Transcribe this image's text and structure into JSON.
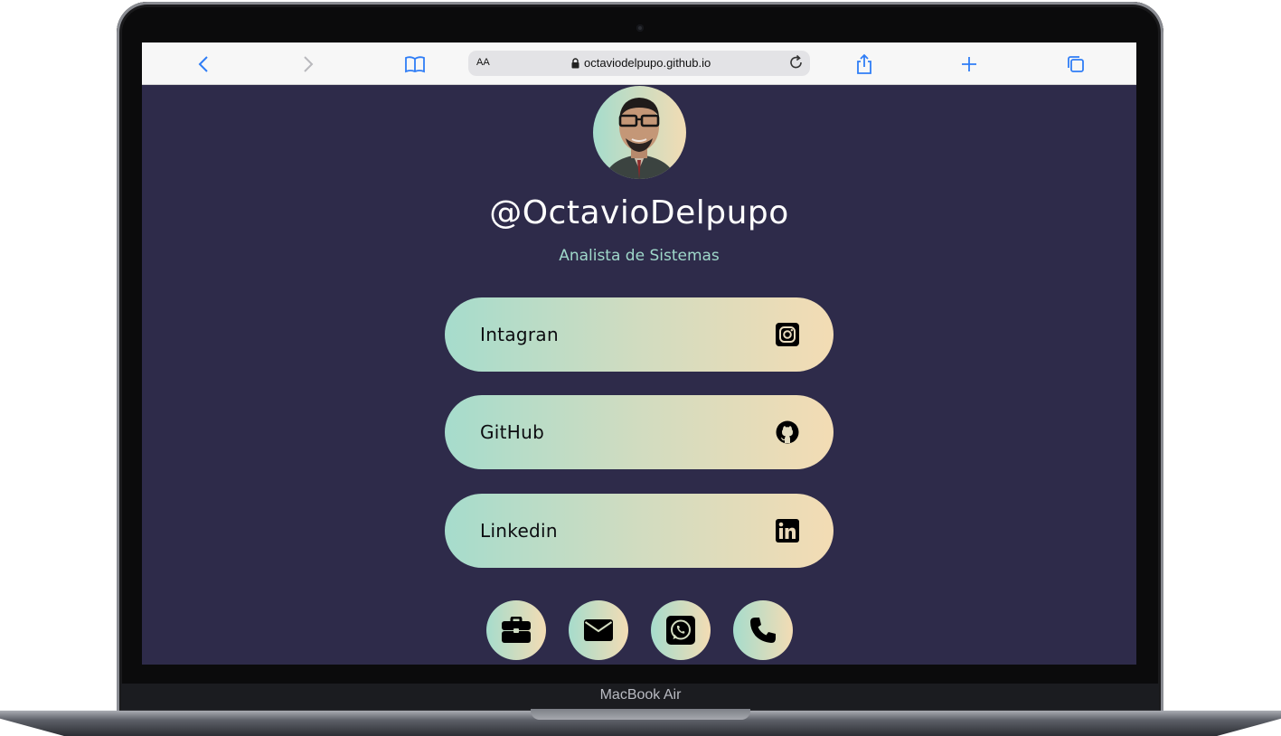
{
  "device": {
    "label": "MacBook Air"
  },
  "browser": {
    "text_size_label": "AA",
    "url": "octaviodelpupo.github.io"
  },
  "profile": {
    "handle": "@OctavioDelpupo",
    "role": "Analista de Sistemas"
  },
  "links": [
    {
      "label": "Intagran",
      "icon": "instagram-icon"
    },
    {
      "label": "GitHub",
      "icon": "github-icon"
    },
    {
      "label": "Linkedin",
      "icon": "linkedin-icon"
    }
  ],
  "contacts": [
    {
      "icon": "briefcase-icon"
    },
    {
      "icon": "envelope-icon"
    },
    {
      "icon": "whatsapp-icon"
    },
    {
      "icon": "phone-icon"
    }
  ],
  "colors": {
    "page_background": "#2e2b4a",
    "gradient_start": "#a6dccc",
    "gradient_end": "#f3dcb4",
    "role_text": "#9fd8ca",
    "safari_accent": "#2f7df6"
  }
}
